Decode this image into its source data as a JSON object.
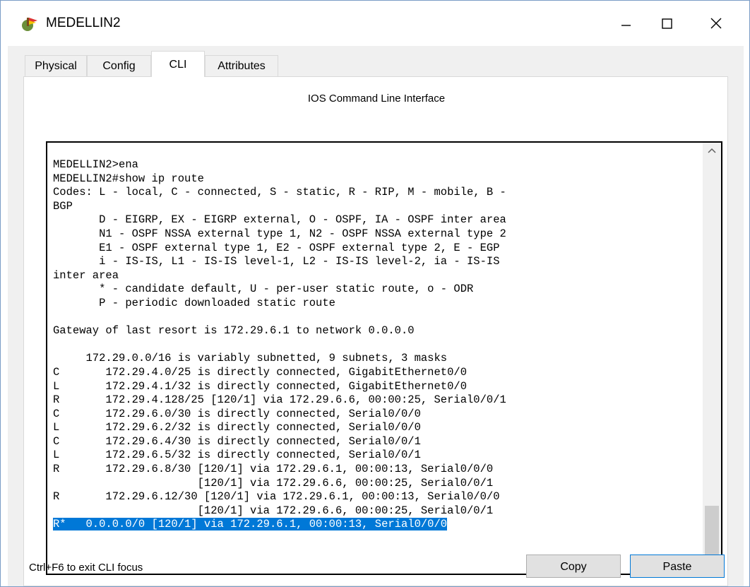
{
  "window": {
    "title": "MEDELLIN2",
    "icon": "router-icon",
    "controls": {
      "minimize": "minimize-icon",
      "maximize": "maximize-icon",
      "close": "close-icon"
    }
  },
  "tabs": [
    {
      "label": "Physical",
      "active": false
    },
    {
      "label": "Config",
      "active": false
    },
    {
      "label": "CLI",
      "active": true
    },
    {
      "label": "Attributes",
      "active": false
    }
  ],
  "cli": {
    "title": "IOS Command Line Interface",
    "lines": [
      "MEDELLIN2>ena",
      "MEDELLIN2#show ip route",
      "Codes: L - local, C - connected, S - static, R - RIP, M - mobile, B -",
      "BGP",
      "       D - EIGRP, EX - EIGRP external, O - OSPF, IA - OSPF inter area",
      "       N1 - OSPF NSSA external type 1, N2 - OSPF NSSA external type 2",
      "       E1 - OSPF external type 1, E2 - OSPF external type 2, E - EGP",
      "       i - IS-IS, L1 - IS-IS level-1, L2 - IS-IS level-2, ia - IS-IS",
      "inter area",
      "       * - candidate default, U - per-user static route, o - ODR",
      "       P - periodic downloaded static route",
      "",
      "Gateway of last resort is 172.29.6.1 to network 0.0.0.0",
      "",
      "     172.29.0.0/16 is variably subnetted, 9 subnets, 3 masks",
      "C       172.29.4.0/25 is directly connected, GigabitEthernet0/0",
      "L       172.29.4.1/32 is directly connected, GigabitEthernet0/0",
      "R       172.29.4.128/25 [120/1] via 172.29.6.6, 00:00:25, Serial0/0/1",
      "C       172.29.6.0/30 is directly connected, Serial0/0/0",
      "L       172.29.6.2/32 is directly connected, Serial0/0/0",
      "C       172.29.6.4/30 is directly connected, Serial0/0/1",
      "L       172.29.6.5/32 is directly connected, Serial0/0/1",
      "R       172.29.6.8/30 [120/1] via 172.29.6.1, 00:00:13, Serial0/0/0",
      "                      [120/1] via 172.29.6.6, 00:00:25, Serial0/0/1",
      "R       172.29.6.12/30 [120/1] via 172.29.6.1, 00:00:13, Serial0/0/0",
      "                      [120/1] via 172.29.6.6, 00:00:25, Serial0/0/1"
    ],
    "selected_line": "R*   0.0.0.0/0 [120/1] via 172.29.6.1, 00:00:13, Serial0/0/0"
  },
  "footer": {
    "hint": "Ctrl+F6 to exit CLI focus",
    "copy_label": "Copy",
    "paste_label": "Paste"
  }
}
